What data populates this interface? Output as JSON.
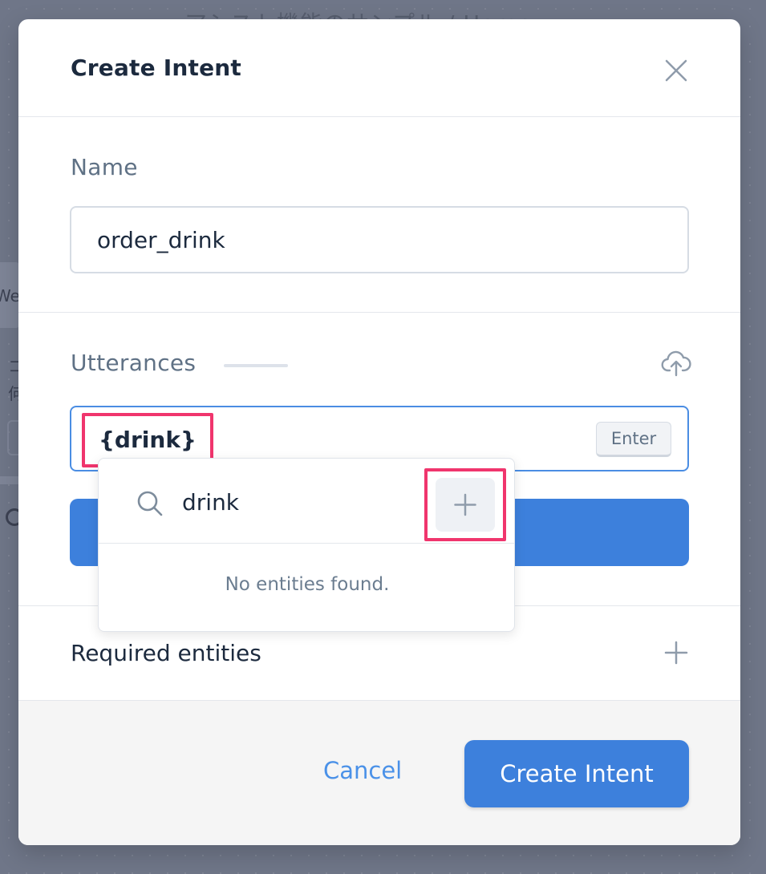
{
  "background": {
    "title": "アシスト機能のサンプル / Home",
    "tab_label": "We",
    "side_chars": [
      "コ",
      "何"
    ]
  },
  "modal": {
    "title": "Create Intent",
    "close_icon": "close-icon",
    "name_section": {
      "label": "Name",
      "value": "order_drink"
    },
    "utterances_section": {
      "label": "Utterances",
      "upload_icon": "cloud-upload-icon",
      "input_value": "{drink}",
      "enter_label": "Enter"
    },
    "entity_dropdown": {
      "search_icon": "search-icon",
      "search_value": "drink",
      "add_icon": "plus-icon",
      "empty_text": "No entities found."
    },
    "required_entities": {
      "label": "Required entities",
      "add_icon": "plus-icon"
    },
    "footer": {
      "cancel_label": "Cancel",
      "create_label": "Create Intent"
    }
  },
  "colors": {
    "accent": "#3d80dc",
    "highlight": "#f0356d",
    "overlay": "#6f7688"
  }
}
